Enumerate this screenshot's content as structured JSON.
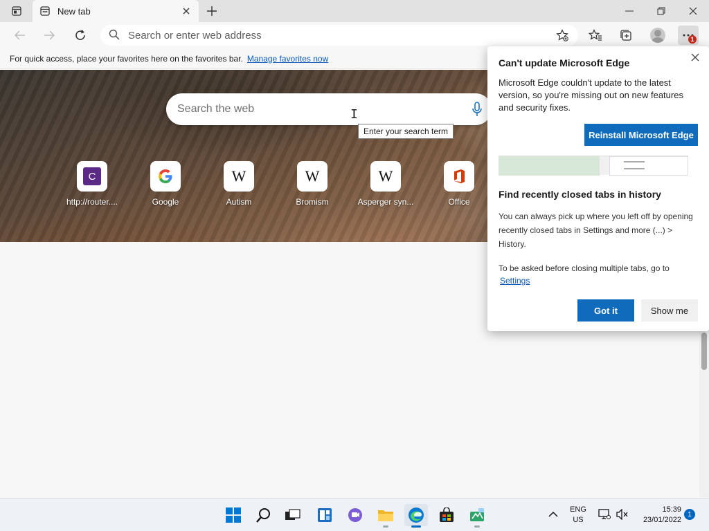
{
  "browser": {
    "tab": {
      "title": "New tab"
    },
    "address": {
      "placeholder": "Search or enter web address"
    }
  },
  "favorites_bar": {
    "message": "For quick access, place your favorites here on the favorites bar.",
    "link": "Manage favorites now"
  },
  "newtab": {
    "search_placeholder": "Search the web",
    "tooltip": "Enter your search term",
    "tiles": [
      {
        "label": "http://router....",
        "icon": "c-letter-icon"
      },
      {
        "label": "Google",
        "icon": "google-icon"
      },
      {
        "label": "Autism",
        "icon": "wikipedia-icon",
        "glyph": "W"
      },
      {
        "label": "Bromism",
        "icon": "wikipedia-icon",
        "glyph": "W"
      },
      {
        "label": "Asperger syn...",
        "icon": "wikipedia-icon",
        "glyph": "W"
      },
      {
        "label": "Office",
        "icon": "office-icon"
      }
    ],
    "c_glyph": "C"
  },
  "popup": {
    "title": "Can't update Microsoft Edge",
    "body": "Microsoft Edge couldn't update to the latest version, so you're missing out on new features and security fixes.",
    "reinstall_label": "Reinstall Microsoft Edge",
    "tip_title": "Find recently closed tabs in history",
    "tip_body": "You can always pick up where you left off by opening recently closed tabs in Settings and more (...) > History.",
    "tip_settings_text": "To be asked before closing multiple tabs, go to",
    "tip_settings_link": "Settings",
    "gotit_label": "Got it",
    "showme_label": "Show me"
  },
  "menu_badge": "1",
  "taskbar": {
    "lang": "ENG",
    "region": "US",
    "time": "15:39",
    "date": "23/01/2022",
    "notifications": "1"
  },
  "colors": {
    "accent": "#0f6cbd",
    "link": "#0a58b8",
    "badge": "#c42b1c"
  }
}
